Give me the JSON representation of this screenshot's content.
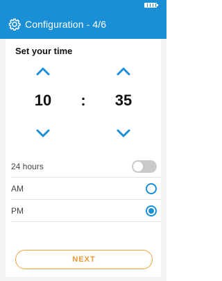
{
  "header": {
    "title": "Configuration - 4/6",
    "icon": "gear-icon"
  },
  "time": {
    "heading": "Set your time",
    "hours": "10",
    "separator": ":",
    "minutes": "35"
  },
  "options": {
    "format_label": "24 hours",
    "format_24h_on": false,
    "am_label": "AM",
    "am_selected": false,
    "pm_label": "PM",
    "pm_selected": true
  },
  "footer": {
    "next_label": "NEXT"
  },
  "colors": {
    "primary": "#1a8fd6",
    "accent": "#e8952c"
  }
}
